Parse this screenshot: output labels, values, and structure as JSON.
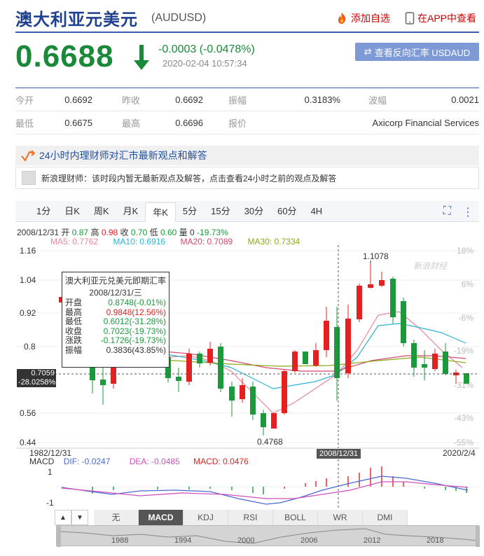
{
  "header": {
    "title": "澳大利亚元美元",
    "symbol": "(AUDUSD)",
    "add_watch": "添加自选",
    "app_view": "在APP中查看"
  },
  "quote": {
    "price": "0.6688",
    "change": "-0.0003 (-0.0478%)",
    "timestamp": "2020-02-04 10:57:34",
    "reverse_button": "查看反向汇率 USDAUD"
  },
  "stats": [
    [
      {
        "label": "今开",
        "value": "0.6692"
      },
      {
        "label": "昨收",
        "value": "0.6692"
      },
      {
        "label": "振幅",
        "value": "0.3183%"
      },
      {
        "label": "波幅",
        "value": "0.0021"
      }
    ],
    [
      {
        "label": "最低",
        "value": "0.6675"
      },
      {
        "label": "最高",
        "value": "0.6696"
      },
      {
        "label": "报价",
        "value": "Axicorp Financial Services"
      }
    ]
  ],
  "news": {
    "head": "24小时内理财师对汇市最新观点和解答",
    "body": "新浪理财师：该时段内暂无最新观点及解答，点击查看24小时之前的观点及解答"
  },
  "tabs": [
    "1分",
    "日K",
    "周K",
    "月K",
    "年K",
    "5分",
    "15分",
    "30分",
    "60分",
    "4H"
  ],
  "active_tab": "年K",
  "ohlc_line": {
    "date": "2008/12/31",
    "open_label": "开",
    "open": "0.87",
    "high_label": "高",
    "high": "0.98",
    "close_label": "收",
    "close": "0.70",
    "low_label": "低",
    "low": "0.60",
    "vol_label": "量",
    "vol": "0",
    "change": "-19.73%"
  },
  "ma_legend": [
    {
      "label": "MA5: 0.7762",
      "color": "#e8879a"
    },
    {
      "label": "MA10: 0.6916",
      "color": "#2bb3d6"
    },
    {
      "label": "MA20: 0.7089",
      "color": "#d04a6a"
    },
    {
      "label": "MA30: 0.7334",
      "color": "#8aaa1a"
    }
  ],
  "y_axis_left": [
    "1.16",
    "1.04",
    "0.92",
    "0.8",
    "0.56",
    "0.44"
  ],
  "y_axis_right": [
    "18%",
    "6%",
    "-6%",
    "-19%",
    "-31%",
    "-43%",
    "-55%"
  ],
  "x_axis": {
    "start": "1982/12/31",
    "end": "2020/2/4"
  },
  "annotations": {
    "max": "1.1078",
    "min": "0.4768"
  },
  "watermark": "新浪财经",
  "tooltip": {
    "title": "澳大利亚元兑美元即期汇率",
    "date": "2008/12/31/三",
    "rows": [
      {
        "label": "开盘",
        "value": "0.8748(-0.01%)",
        "color": "#1a9a3a"
      },
      {
        "label": "最高",
        "value": "0.9848(12.56%)",
        "color": "#d22"
      },
      {
        "label": "最低",
        "value": "0.6012(-31.28%)",
        "color": "#1a9a3a"
      },
      {
        "label": "收盘",
        "value": "0.7023(-19.73%)",
        "color": "#1a9a3a"
      },
      {
        "label": "涨跌",
        "value": "-0.1726(-19.73%)",
        "color": "#1a9a3a"
      },
      {
        "label": "振幅",
        "value": "0.3836(43.85%)",
        "color": "#333"
      }
    ]
  },
  "crosshair": {
    "price": "0.7059",
    "pct": "-28.0258%",
    "date": "2008/12/31"
  },
  "macd": {
    "label": "MACD",
    "dif": "DIF: -0.0247",
    "dea": "DEA: -0.0485",
    "macd": "MACD: 0.0476",
    "axis": [
      "1",
      "-1"
    ]
  },
  "indicators": [
    "无",
    "MACD",
    "KDJ",
    "RSI",
    "BOLL",
    "WR",
    "DMI"
  ],
  "active_indicator": "MACD",
  "navigator_years": [
    "1988",
    "1994",
    "2000",
    "2006",
    "2012",
    "2018"
  ],
  "colors": {
    "up": "#e52020",
    "down": "#1a9a3a",
    "brand": "#1f3f8f"
  }
}
